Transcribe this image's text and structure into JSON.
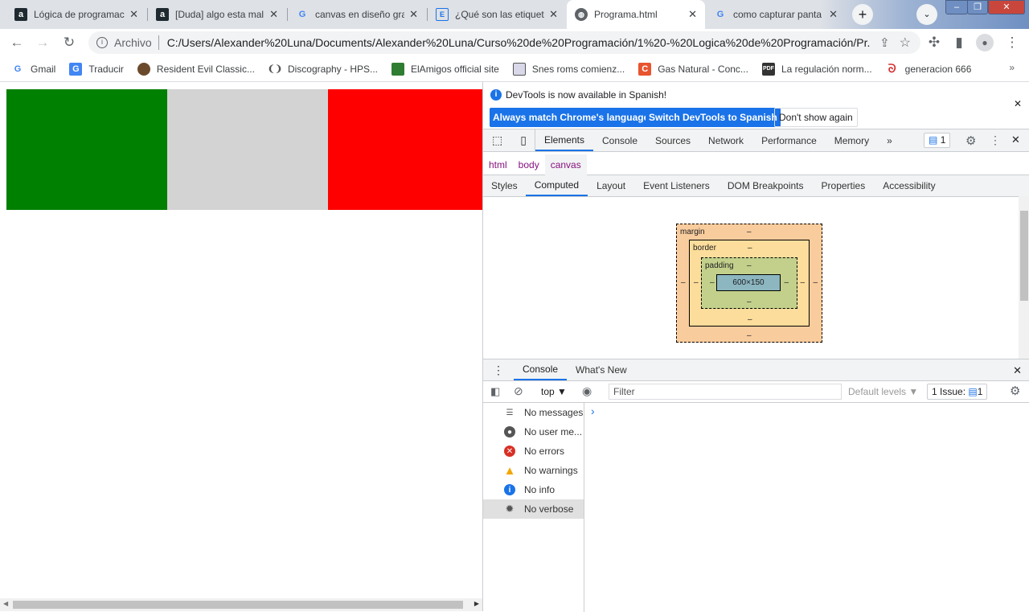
{
  "tabs": [
    {
      "title": "Lógica de programac",
      "icon": "alura-icon"
    },
    {
      "title": "[Duda] algo esta mal",
      "icon": "alura-icon"
    },
    {
      "title": "canvas en diseño gra",
      "icon": "google-icon"
    },
    {
      "title": "¿Qué son las etiqueta",
      "icon": "e-icon"
    },
    {
      "title": "Programa.html",
      "icon": "globe-icon",
      "active": true
    },
    {
      "title": "como capturar panta",
      "icon": "google-icon"
    }
  ],
  "address": {
    "scheme": "Archivo",
    "url": "C:/Users/Alexander%20Luna/Documents/Alexander%20Luna/Curso%20de%20Programación/1%20-%20Logica%20de%20Programación/Pr..."
  },
  "bookmarks": [
    {
      "label": "Gmail",
      "icon": "google-icon"
    },
    {
      "label": "Traducir",
      "icon": "translate-icon"
    },
    {
      "label": "Resident Evil Classic...",
      "icon": "resident-evil-icon"
    },
    {
      "label": "Discography - HPS...",
      "icon": "hps-icon"
    },
    {
      "label": "ElAmigos official site",
      "icon": "elamigos-icon"
    },
    {
      "label": "Snes roms comienz...",
      "icon": "snes-icon"
    },
    {
      "label": "Gas Natural - Conc...",
      "icon": "gas-natural-icon"
    },
    {
      "label": "La regulación norm...",
      "icon": "pdf-icon"
    },
    {
      "label": "generacion 666",
      "icon": "generacion-icon"
    }
  ],
  "canvas": {
    "colors": [
      "#008000",
      "#d3d3d3",
      "#ff0000"
    ]
  },
  "devtools": {
    "info": "DevTools is now available in Spanish!",
    "btn_match": "Always match Chrome's language",
    "btn_switch": "Switch DevTools to Spanish",
    "btn_dont": "Don't show again",
    "tabs": [
      "Elements",
      "Console",
      "Sources",
      "Network",
      "Performance",
      "Memory"
    ],
    "more": "»",
    "issues_badge": "1",
    "crumbs": [
      "html",
      "body",
      "canvas"
    ],
    "subtabs": [
      "Styles",
      "Computed",
      "Layout",
      "Event Listeners",
      "DOM Breakpoints",
      "Properties",
      "Accessibility"
    ],
    "boxmodel": {
      "margin": "margin",
      "border": "border",
      "padding": "padding",
      "content": "600×150",
      "dash": "–"
    },
    "drawer_tabs": [
      "Console",
      "What's New"
    ],
    "context": "top ▼",
    "filter_placeholder": "Filter",
    "levels": "Default levels ▼",
    "issues": "1 Issue:",
    "issues_count": "1",
    "prompt": "›",
    "sidebar": [
      {
        "label": "No messages",
        "icon": "list-icon"
      },
      {
        "label": "No user me...",
        "icon": "user-icon"
      },
      {
        "label": "No errors",
        "icon": "error-icon"
      },
      {
        "label": "No warnings",
        "icon": "warning-icon"
      },
      {
        "label": "No info",
        "icon": "info-icon"
      },
      {
        "label": "No verbose",
        "icon": "bug-icon"
      }
    ]
  }
}
